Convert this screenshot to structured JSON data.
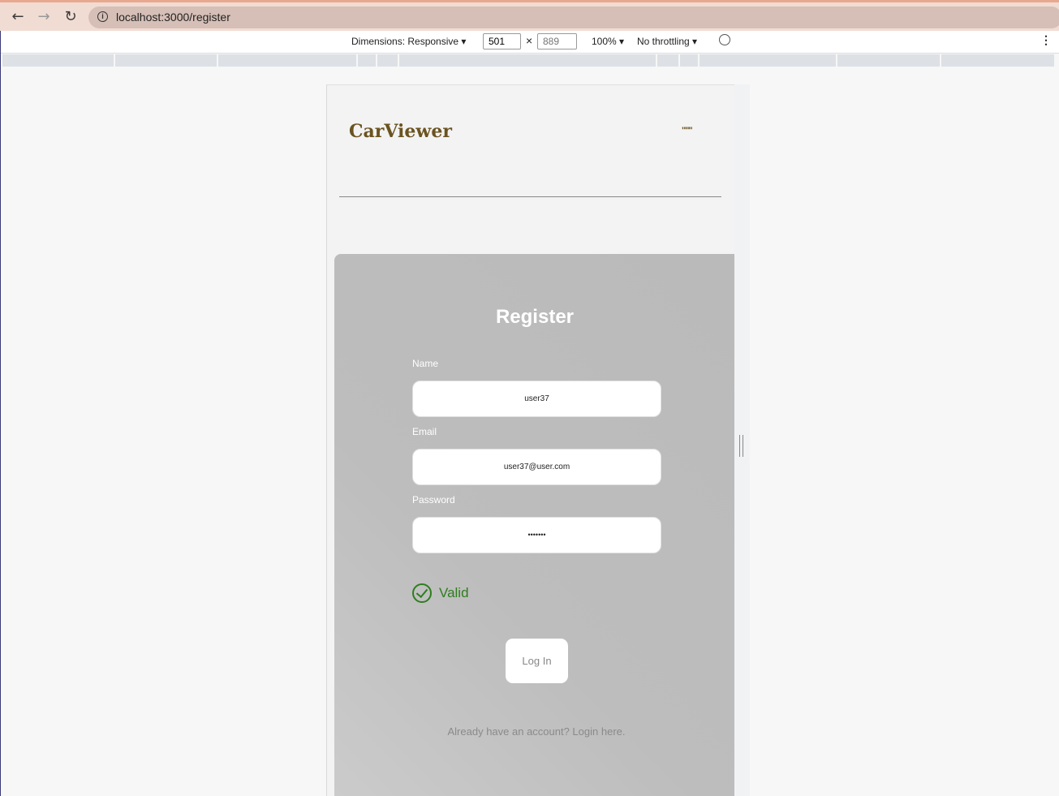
{
  "browser": {
    "url": "localhost:3000/register"
  },
  "devtools": {
    "dimensions_label": "Dimensions: Responsive ▾",
    "width_value": "501",
    "times": "×",
    "height_placeholder": "889",
    "zoom": "100% ▾",
    "throttling": "No throttling ▾"
  },
  "site": {
    "logo": "CarViewer",
    "menu_icon_text": "\"\"\""
  },
  "form": {
    "title": "Register",
    "name_label": "Name",
    "name_value": "user37",
    "email_label": "Email",
    "email_value": "user37@user.com",
    "password_label": "Password",
    "password_value": "•••••••",
    "valid_text": "Valid",
    "submit_label": "Log In",
    "login_link": "Already have an account? Login here."
  },
  "colors": {
    "brand": "#6b5320",
    "valid": "#2e7d1e"
  }
}
